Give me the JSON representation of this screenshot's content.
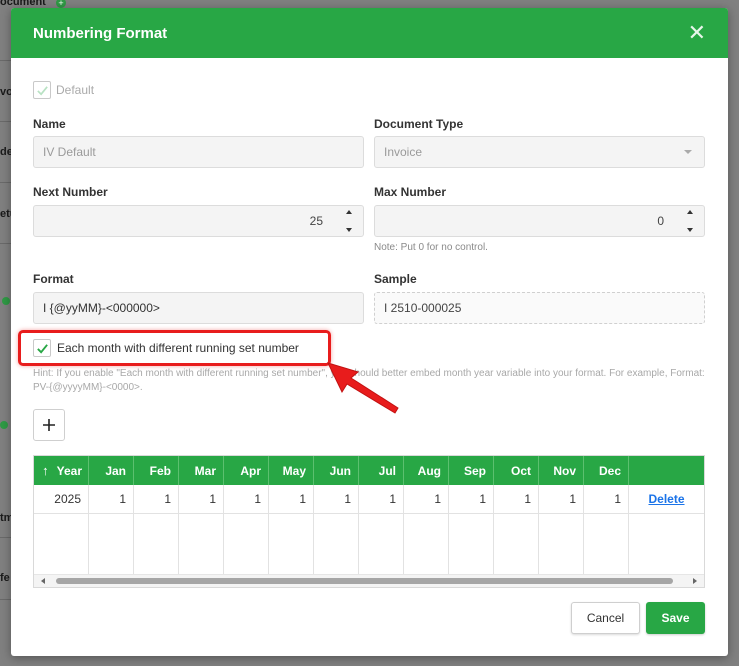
{
  "background": {
    "fragments": [
      "ocument",
      "vo",
      "de",
      "etu",
      "tm",
      "fe"
    ]
  },
  "dialog": {
    "title": "Numbering Format",
    "close_icon": "close-icon",
    "default_label": "Default",
    "name_label": "Name",
    "name_value": "IV Default",
    "doctype_label": "Document Type",
    "doctype_value": "Invoice",
    "next_label": "Next Number",
    "next_value": "25",
    "max_label": "Max Number",
    "max_value": "0",
    "max_note": "Note: Put 0 for no control.",
    "format_label": "Format",
    "format_value": "I {@yyMM}-<000000>",
    "sample_label": "Sample",
    "sample_value": "I 2510-000025",
    "monthly_label": "Each month with different running set number",
    "hint_line1": "Hint: If you enable \"Each month with different running set number\", you should better embed month year variable into your format. For example, Format:",
    "hint_line2": "PV-{@yyyyMM}-<0000>."
  },
  "table": {
    "headers": [
      "Year",
      "Jan",
      "Feb",
      "Mar",
      "Apr",
      "May",
      "Jun",
      "Jul",
      "Aug",
      "Sep",
      "Oct",
      "Nov",
      "Dec",
      ""
    ],
    "rows": [
      [
        "2025",
        "1",
        "1",
        "1",
        "1",
        "1",
        "1",
        "1",
        "1",
        "1",
        "1",
        "1",
        "1",
        "Delete"
      ]
    ]
  },
  "buttons": {
    "cancel": "Cancel",
    "save": "Save"
  },
  "colors": {
    "accent": "#28a745",
    "highlight": "#e81c1c",
    "link": "#1a73e8"
  }
}
